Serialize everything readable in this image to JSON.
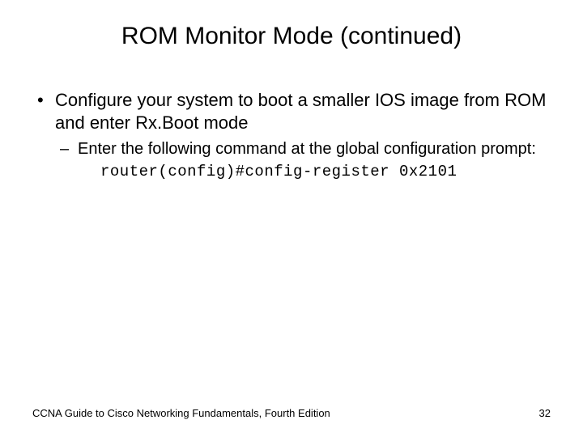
{
  "title": "ROM Monitor Mode (continued)",
  "bullets": {
    "l1_item1": "Configure your system to boot a smaller IOS image from ROM and enter Rx.Boot mode",
    "l2_item1": "Enter the following command at the global configuration prompt:",
    "code": "router(config)#config-register 0x2101"
  },
  "footer": {
    "text": "CCNA Guide to Cisco Networking Fundamentals, Fourth Edition",
    "page": "32"
  }
}
